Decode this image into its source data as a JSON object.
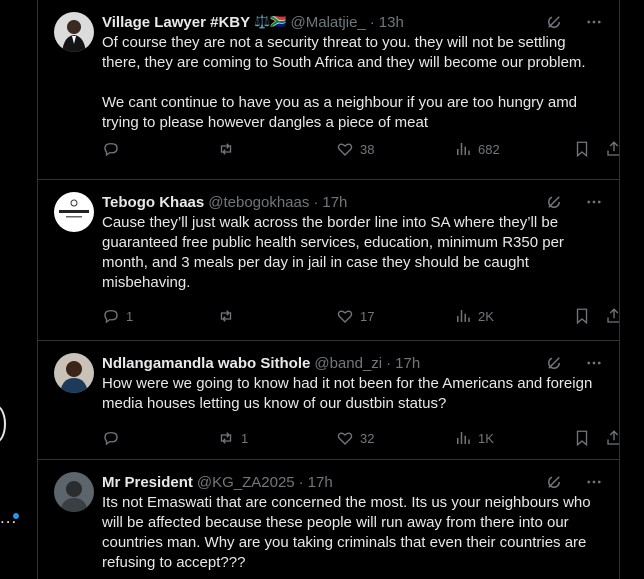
{
  "tweets": [
    {
      "name": "Village Lawyer #KBY",
      "badge": "⚖️🇿🇦",
      "handle": "@Malatjie_",
      "time": "13h",
      "text": "Of course they are not a security threat to you. they will not be settling there, they are coming to South Africa and they will become our problem.\n\nWe cant continue to have you as a neighbour if you are too hungry amd trying to please however dangles a piece of meat",
      "replies": "",
      "retweets": "",
      "likes": "38",
      "views": "682"
    },
    {
      "name": "Tebogo Khaas",
      "handle": "@tebogokhaas",
      "time": "17h",
      "text": "Cause they’ll just walk across the border line into SA where they’ll be guaranteed free public health services, education, minimum R350 per month, and 3 meals per day in jail in case they should be caught misbehaving.",
      "replies": "1",
      "retweets": "",
      "likes": "17",
      "views": "2K",
      "avatar_text": "CONSCIENTIOUS"
    },
    {
      "name": "Ndlangamandla wabo Sithole",
      "handle": "@band_zi",
      "time": "17h",
      "text": "How were we going to know had it not been for the Americans and foreign media houses letting us know of our dustbin status?",
      "replies": "",
      "retweets": "1",
      "likes": "32",
      "views": "1K"
    },
    {
      "name": "Mr President",
      "handle": "@KG_ZA2025",
      "time": "17h",
      "text": "Its not Emaswati that are concerned the most. Its us your neighbours who will be affected because these people will run away from there into our countries man. Why are you taking criminals that even their countries are refusing to accept???"
    }
  ],
  "separator": "·",
  "left_edge": {
    "dots": "..."
  }
}
